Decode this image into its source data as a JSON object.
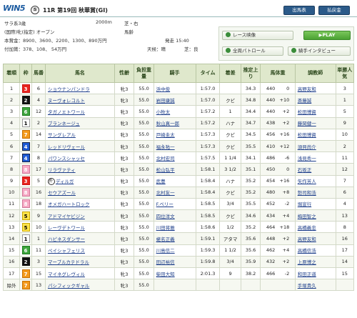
{
  "header": {
    "logo": "WIN5",
    "race_no_mark": "⑤",
    "race_title": "11R 第19回 秋華賞(GI)",
    "btn_entries": "出馬表",
    "btn_payout": "払戻金"
  },
  "info": {
    "class": "サラ系3歳",
    "distance": "2000m",
    "surface": "芝・右",
    "condition": "(国際)牝(指定) オープン",
    "weight_rule": "馬齢",
    "prize_label": "本賞金：",
    "prize": "8900、3600、2200、1300、890万円",
    "addl_label": "付加賞：",
    "addl": "378、108、 54万円",
    "post_time": "発走 15:40",
    "weather": "天候：晴",
    "going": "芝：良"
  },
  "panel": {
    "video": "レース映像",
    "play": "▶PLAY",
    "patrol": "全周パトロール",
    "interview": "騎手インタビュー"
  },
  "table": {
    "headers": [
      "着順",
      "枠",
      "馬番",
      "馬名",
      "性齢",
      "負担重量",
      "騎手",
      "タイム",
      "着差",
      "推定上り",
      "馬体重",
      "調教師",
      "単勝人気"
    ],
    "rows": [
      {
        "pos": "1",
        "waku": "3",
        "no": "6",
        "name": "ショウナンパンドラ",
        "sa": "牝3",
        "wt": "55.0",
        "jockey": "浜中俊",
        "time": "1:57.0",
        "margin": "",
        "last": "34.3",
        "bw": "440",
        "bwd": "0",
        "trainer": "高野友和",
        "pop": "3"
      },
      {
        "pos": "2",
        "waku": "2",
        "no": "4",
        "name": "ヌーヴォレコルト",
        "sa": "牝3",
        "wt": "55.0",
        "jockey": "岩田康誠",
        "time": "1:57.0",
        "margin": "クビ",
        "last": "34.8",
        "bw": "440",
        "bwd": "+10",
        "trainer": "斎藤誠",
        "pop": "1"
      },
      {
        "pos": "3",
        "waku": "6",
        "no": "12",
        "name": "タガノエトワール",
        "sa": "牝3",
        "wt": "55.0",
        "jockey": "小牧太",
        "time": "1:57.2",
        "margin": "1",
        "last": "34.4",
        "bw": "440",
        "bwd": "+2",
        "trainer": "松田博資",
        "pop": "5"
      },
      {
        "pos": "4",
        "waku": "1",
        "no": "2",
        "name": "ブランネージュ",
        "sa": "牝3",
        "wt": "55.0",
        "jockey": "秋山真一郎",
        "time": "1:57.2",
        "margin": "ハナ",
        "last": "34.7",
        "bw": "438",
        "bwd": "+2",
        "trainer": "藤岡健一",
        "pop": "9"
      },
      {
        "pos": "5",
        "waku": "7",
        "no": "14",
        "name": "サングレアル",
        "sa": "牝3",
        "wt": "55.0",
        "jockey": "戸崎圭太",
        "time": "1:57.3",
        "margin": "クビ",
        "last": "34.5",
        "bw": "456",
        "bwd": "+16",
        "trainer": "松田博資",
        "pop": "10"
      },
      {
        "pos": "6",
        "waku": "4",
        "no": "7",
        "name": "レッドリヴェール",
        "sa": "牝3",
        "wt": "55.0",
        "jockey": "福永祐一",
        "time": "1:57.3",
        "margin": "クビ",
        "last": "35.5",
        "bw": "410",
        "bwd": "+12",
        "trainer": "須貝尚介",
        "pop": "2"
      },
      {
        "pos": "7",
        "waku": "4",
        "no": "8",
        "name": "パワンスシャッセ",
        "sa": "牝3",
        "wt": "55.0",
        "jockey": "北村宏司",
        "time": "1:57.5",
        "margin": "1 1/4",
        "last": "34.1",
        "bw": "486",
        "bwd": "-6",
        "trainer": "浅見秀一",
        "pop": "11"
      },
      {
        "pos": "8",
        "waku": "8",
        "no": "17",
        "name": "リラヴァティ",
        "sa": "牝3",
        "wt": "55.0",
        "jockey": "松山弘平",
        "time": "1:58.1",
        "margin": "3 1/2",
        "last": "35.1",
        "bw": "450",
        "bwd": "0",
        "trainer": "石坂正",
        "pop": "12"
      },
      {
        "pos": "9",
        "waku": "3",
        "no": "5",
        "name": "ディルガ",
        "sa": "牝3",
        "wt": "55.0",
        "jockey": "武豊",
        "time": "1:58.4",
        "margin": "ハナ",
        "last": "35.2",
        "bw": "454",
        "bwd": "+16",
        "trainer": "矢作芳人",
        "pop": "7",
        "mark": "外"
      },
      {
        "pos": "10",
        "waku": "8",
        "no": "16",
        "name": "セウアズール",
        "sa": "牝3",
        "wt": "55.0",
        "jockey": "北村友一",
        "time": "1:58.4",
        "margin": "クビ",
        "last": "35.2",
        "bw": "480",
        "bwd": "+8",
        "trainer": "勢司和浩",
        "pop": "6"
      },
      {
        "pos": "11",
        "waku": "8",
        "no": "18",
        "name": "オメガハートロック",
        "sa": "牝3",
        "wt": "55.0",
        "jockey": "F.ベリー",
        "time": "1:58.5",
        "margin": "3/4",
        "last": "35.5",
        "bw": "452",
        "bwd": "-2",
        "trainer": "堀宣行",
        "pop": "4"
      },
      {
        "pos": "12",
        "waku": "5",
        "no": "9",
        "name": "アドマイヤビジン",
        "sa": "牝3",
        "wt": "55.0",
        "jockey": "四位洋文",
        "time": "1:58.5",
        "margin": "クビ",
        "last": "34.6",
        "bw": "434",
        "bwd": "+4",
        "trainer": "梅田智之",
        "pop": "13"
      },
      {
        "pos": "13",
        "waku": "5",
        "no": "10",
        "name": "レーヴデトワール",
        "sa": "牝3",
        "wt": "55.0",
        "jockey": "川田将雅",
        "time": "1:58.6",
        "margin": "1/2",
        "last": "35.2",
        "bw": "464",
        "bwd": "+18",
        "trainer": "高橋義忠",
        "pop": "8"
      },
      {
        "pos": "14",
        "waku": "1",
        "no": "1",
        "name": "ハピネスダンサー",
        "sa": "牝3",
        "wt": "55.0",
        "jockey": "蛯名正義",
        "time": "1:59.1",
        "margin": "アタマ",
        "last": "35.6",
        "bw": "448",
        "bwd": "+2",
        "trainer": "高野友和",
        "pop": "16"
      },
      {
        "pos": "15",
        "waku": "6",
        "no": "11",
        "name": "ペイシャフェリス",
        "sa": "牝3",
        "wt": "55.0",
        "jockey": "川島信二",
        "time": "1:59.3",
        "margin": "1 1/2",
        "last": "35.6",
        "bw": "462",
        "bwd": "+4",
        "trainer": "高橋信浩",
        "pop": "17"
      },
      {
        "pos": "16",
        "waku": "2",
        "no": "3",
        "name": "マーブルカテドラル",
        "sa": "牝3",
        "wt": "55.0",
        "jockey": "田辺裕信",
        "time": "1:59.8",
        "margin": "3/4",
        "last": "35.9",
        "bw": "432",
        "bwd": "+2",
        "trainer": "上原博之",
        "pop": "14"
      },
      {
        "pos": "17",
        "waku": "7",
        "no": "15",
        "name": "マイネグレヴィル",
        "sa": "牝3",
        "wt": "55.0",
        "jockey": "柴田大知",
        "time": "2:01.3",
        "margin": "9",
        "last": "38.2",
        "bw": "466",
        "bwd": "-2",
        "trainer": "和田正道",
        "pop": "15"
      },
      {
        "pos": "除外",
        "waku": "7",
        "no": "13",
        "name": "パシフィックギャル",
        "sa": "牝3",
        "wt": "55.0",
        "jockey": "",
        "time": "",
        "margin": "",
        "last": "",
        "bw": "",
        "bwd": "",
        "trainer": "手塚貴久",
        "pop": ""
      }
    ]
  }
}
